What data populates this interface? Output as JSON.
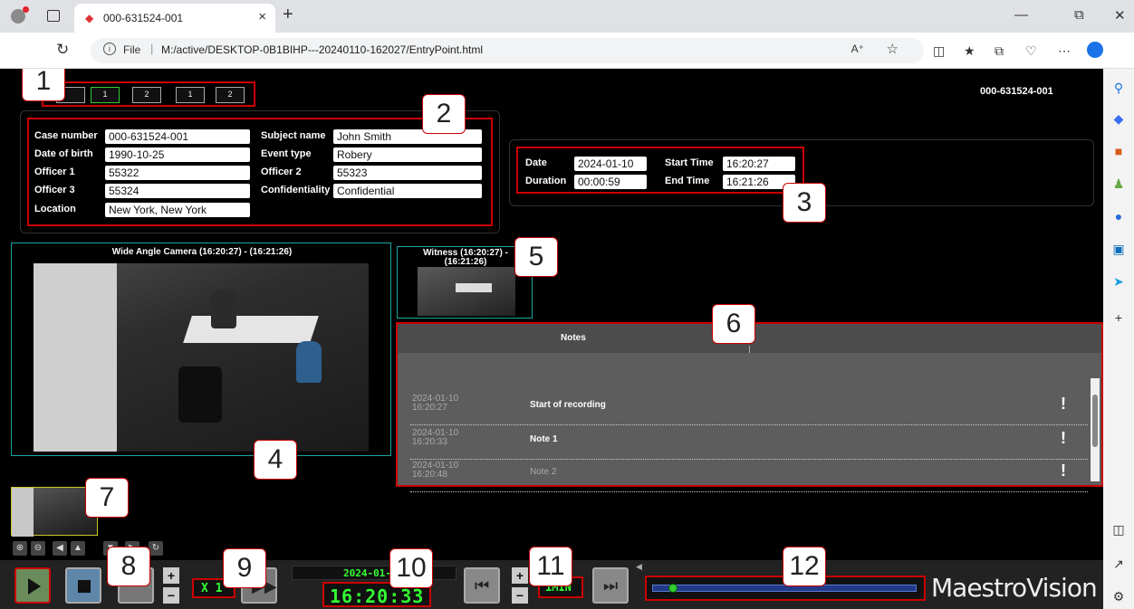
{
  "browser": {
    "tab_title": "000-631524-001",
    "url_scheme": "File",
    "url": "M:/active/DESKTOP-0B1BIHP---20240110-162027/EntryPoint.html"
  },
  "app": {
    "case_id": "000-631524-001",
    "layout_buttons": [
      "",
      "1",
      "2",
      "1",
      "2"
    ],
    "case": {
      "case_number_label": "Case number",
      "case_number": "000-631524-001",
      "dob_label": "Date of birth",
      "dob": "1990-10-25",
      "officer1_label": "Officer 1",
      "officer1": "55322",
      "officer3_label": "Officer 3",
      "officer3": "55324",
      "location_label": "Location",
      "location": "New York, New York",
      "subject_label": "Subject name",
      "subject": "John Smith",
      "event_label": "Event type",
      "event": "Robery",
      "officer2_label": "Officer 2",
      "officer2": "55323",
      "conf_label": "Confidentiality",
      "conf": "Confidential"
    },
    "session": {
      "date_label": "Date",
      "date": "2024-01-10",
      "duration_label": "Duration",
      "duration": "00:00:59",
      "start_label": "Start Time",
      "start": "16:20:27",
      "end_label": "End Time",
      "end": "16:21:26"
    },
    "cameras": {
      "main_title": "Wide Angle Camera (16:20:27) - (16:21:26)",
      "witness_title_1": "Witness (16:20:27) -",
      "witness_title_2": "(16:21:26)"
    },
    "notes": {
      "title": "Notes",
      "rows": [
        {
          "date": "2024-01-10",
          "time": "16:20:27",
          "text": "Start of recording",
          "flag": "!"
        },
        {
          "date": "2024-01-10",
          "time": "16:20:33",
          "text": "Note 1",
          "flag": "!"
        },
        {
          "date": "2024-01-10",
          "time": "16:20:48",
          "text": "Note 2",
          "flag": "!"
        }
      ]
    },
    "player": {
      "speed": "X 1",
      "date_lcd": "2024-01-",
      "time_lcd": "16:20:33",
      "step_lcd": "1MIN",
      "brand": "MaestroVision",
      "progress": 0.08
    },
    "callouts": [
      "1",
      "2",
      "3",
      "4",
      "5",
      "6",
      "7",
      "8",
      "9",
      "10",
      "11",
      "12"
    ]
  }
}
